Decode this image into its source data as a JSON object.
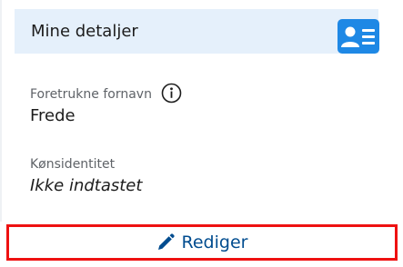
{
  "card": {
    "title": "Mine detaljer",
    "icon": "contact-card-icon"
  },
  "fields": [
    {
      "label": "Foretrukne fornavn",
      "value": "Frede",
      "info_icon": "info-icon"
    },
    {
      "label": "Kønsidentitet",
      "value": "Ikke indtastet"
    }
  ],
  "actions": {
    "edit_label": "Rediger",
    "edit_icon": "pencil-icon"
  },
  "colors": {
    "header_bg": "#e5f0fb",
    "accent": "#1e88e5",
    "link": "#004c8f",
    "highlight_border": "#ee1111"
  }
}
